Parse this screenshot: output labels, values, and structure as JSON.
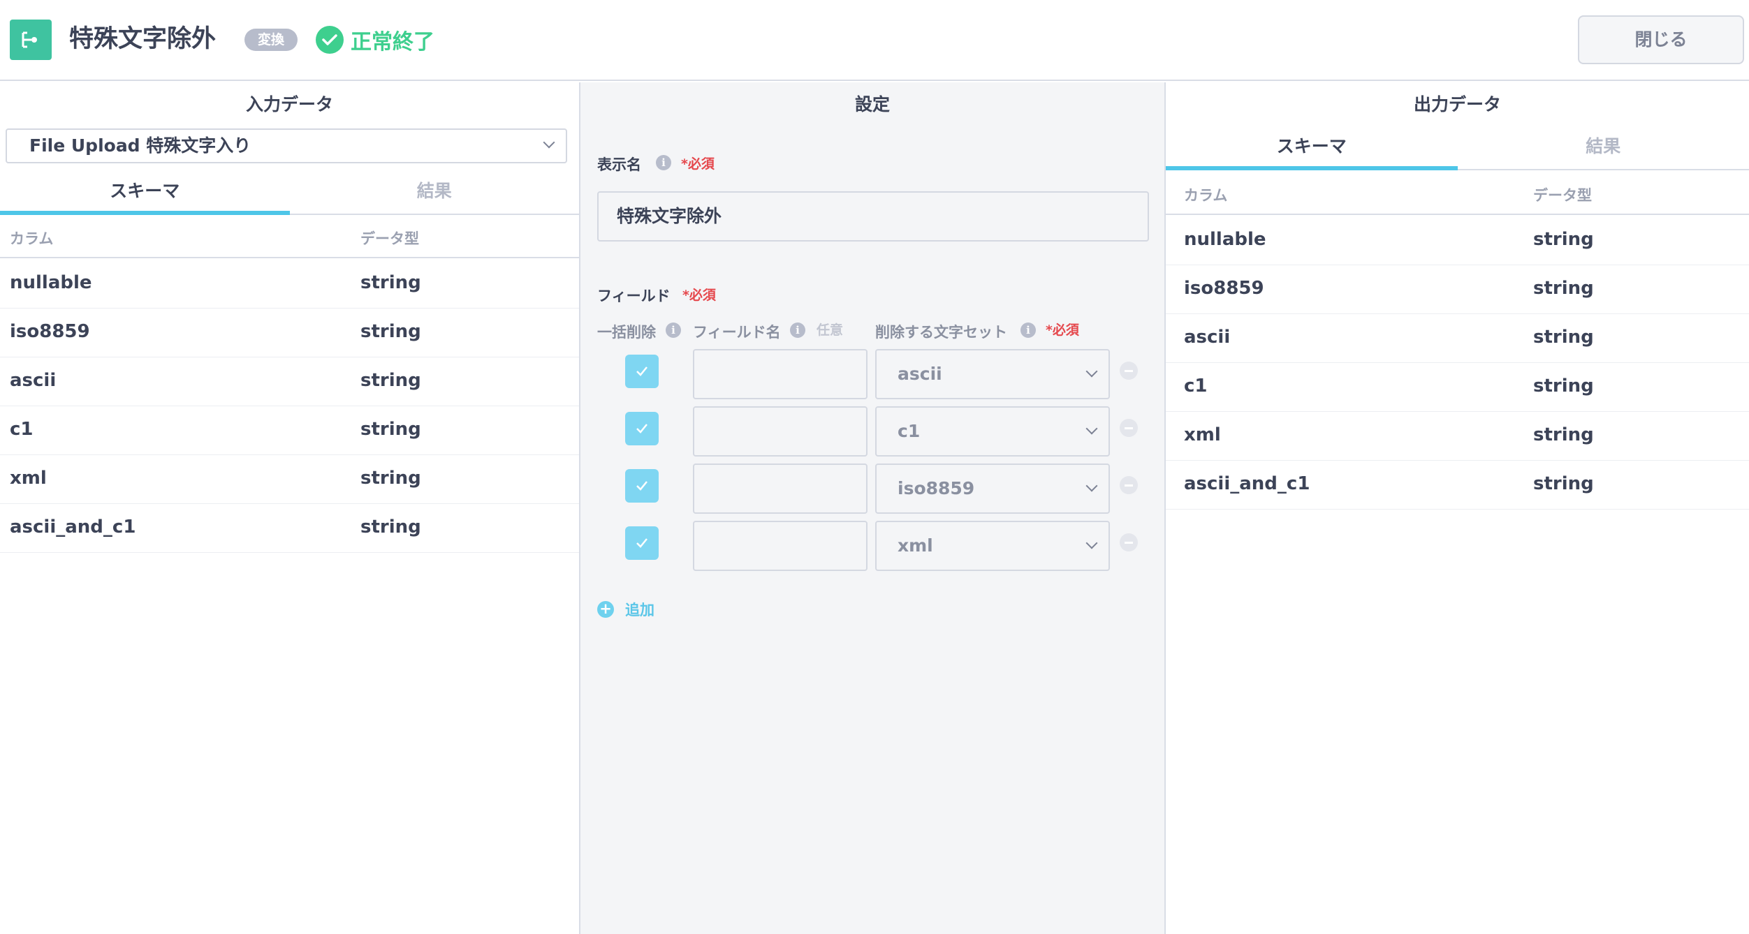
{
  "header": {
    "app_icon": "flow-node-icon",
    "title": "特殊文字除外",
    "type_badge": "変換",
    "status": "正常終了",
    "close_label": "閉じる"
  },
  "input_panel": {
    "title": "入力データ",
    "source_select": "File Upload 特殊文字入り",
    "tabs": [
      "スキーマ",
      "結果"
    ],
    "active_tab": "スキーマ",
    "columns": [
      "カラム",
      "データ型"
    ],
    "rows": [
      [
        "nullable",
        "string"
      ],
      [
        "iso8859",
        "string"
      ],
      [
        "ascii",
        "string"
      ],
      [
        "c1",
        "string"
      ],
      [
        "xml",
        "string"
      ],
      [
        "ascii_and_c1",
        "string"
      ]
    ]
  },
  "settings": {
    "title": "設定",
    "display_name_label": "表示名",
    "required": "*必須",
    "display_name_value": "特殊文字除外",
    "fields_label": "フィールド",
    "bulk_delete_label": "一括削除",
    "field_name_label": "フィールド名",
    "optional": "任意",
    "charset_label": "削除する文字セット",
    "fields": [
      {
        "bulk": true,
        "name": "",
        "charset": "ascii"
      },
      {
        "bulk": true,
        "name": "",
        "charset": "c1"
      },
      {
        "bulk": true,
        "name": "",
        "charset": "iso8859"
      },
      {
        "bulk": true,
        "name": "",
        "charset": "xml"
      }
    ],
    "add_label": "追加"
  },
  "output_panel": {
    "title": "出力データ",
    "tabs": [
      "スキーマ",
      "結果"
    ],
    "active_tab": "スキーマ",
    "columns": [
      "カラム",
      "データ型"
    ],
    "rows": [
      [
        "nullable",
        "string"
      ],
      [
        "iso8859",
        "string"
      ],
      [
        "ascii",
        "string"
      ],
      [
        "c1",
        "string"
      ],
      [
        "xml",
        "string"
      ],
      [
        "ascii_and_c1",
        "string"
      ]
    ]
  },
  "colors": {
    "accent": "#4ec6e8",
    "success": "#3ecf8e",
    "app_icon": "#3fc3a0",
    "required": "#e5484d"
  }
}
